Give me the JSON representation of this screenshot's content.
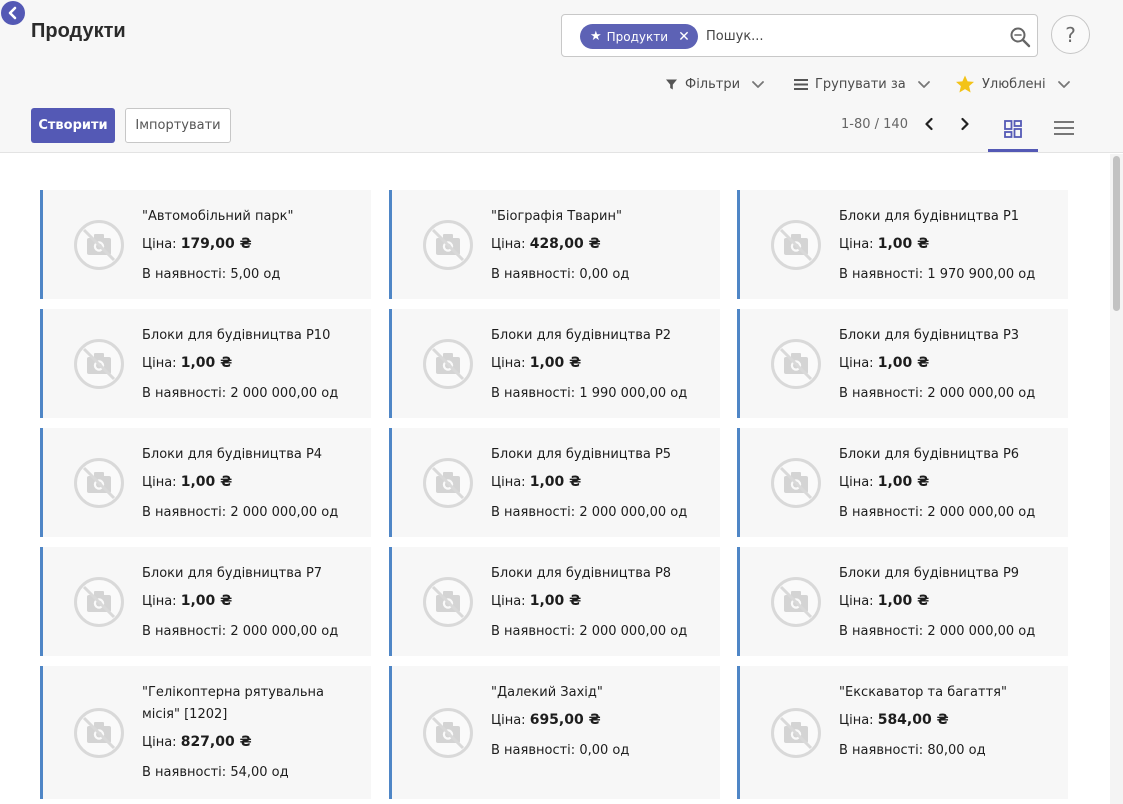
{
  "header": {
    "title": "Продукти",
    "help_label": "?"
  },
  "search": {
    "facet_label": "Продукти",
    "placeholder": "Пошук..."
  },
  "toolbar": {
    "filters_label": "Фільтри",
    "group_by_label": "Групувати за",
    "favorites_label": "Улюблені",
    "create_label": "Створити",
    "import_label": "Імпортувати"
  },
  "pager": {
    "text": "1-80 / 140"
  },
  "views": {
    "active": "kanban"
  },
  "colors": {
    "accent": "#5459b5",
    "card_border": "#4f86c6",
    "favorite_star": "#f3c318"
  },
  "labels": {
    "price_prefix": "Ціна:",
    "stock_prefix": "В наявності:"
  },
  "products": [
    {
      "name": "\"Автомобільний парк\"",
      "price": "179,00 ₴",
      "stock": "5,00 од"
    },
    {
      "name": "\"Біографія Тварин\"",
      "price": "428,00 ₴",
      "stock": "0,00 од"
    },
    {
      "name": "Блоки для будівництва P1",
      "price": "1,00 ₴",
      "stock": "1 970 900,00 од"
    },
    {
      "name": "Блоки для будівництва P10",
      "price": "1,00 ₴",
      "stock": "2 000 000,00 од"
    },
    {
      "name": "Блоки для будівництва P2",
      "price": "1,00 ₴",
      "stock": "1 990 000,00 од"
    },
    {
      "name": "Блоки для будівництва P3",
      "price": "1,00 ₴",
      "stock": "2 000 000,00 од"
    },
    {
      "name": "Блоки для будівництва P4",
      "price": "1,00 ₴",
      "stock": "2 000 000,00 од"
    },
    {
      "name": "Блоки для будівництва P5",
      "price": "1,00 ₴",
      "stock": "2 000 000,00 од"
    },
    {
      "name": "Блоки для будівництва P6",
      "price": "1,00 ₴",
      "stock": "2 000 000,00 од"
    },
    {
      "name": "Блоки для будівництва P7",
      "price": "1,00 ₴",
      "stock": "2 000 000,00 од"
    },
    {
      "name": "Блоки для будівництва P8",
      "price": "1,00 ₴",
      "stock": "2 000 000,00 од"
    },
    {
      "name": "Блоки для будівництва P9",
      "price": "1,00 ₴",
      "stock": "2 000 000,00 од"
    },
    {
      "name": "\"Гелікоптерна рятувальна місія\" [1202]",
      "price": "827,00 ₴",
      "stock": "54,00 од"
    },
    {
      "name": "\"Далекий Захід\"",
      "price": "695,00 ₴",
      "stock": "0,00 од"
    },
    {
      "name": "\"Екскаватор та багаття\"",
      "price": "584,00 ₴",
      "stock": "80,00 од"
    }
  ]
}
